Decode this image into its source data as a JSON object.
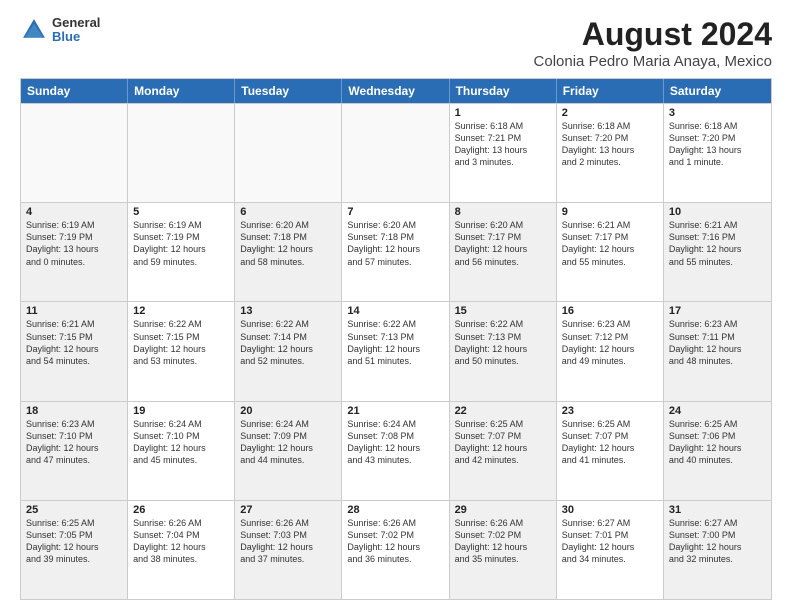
{
  "logo": {
    "general": "General",
    "blue": "Blue"
  },
  "title": "August 2024",
  "subtitle": "Colonia Pedro Maria Anaya, Mexico",
  "header_days": [
    "Sunday",
    "Monday",
    "Tuesday",
    "Wednesday",
    "Thursday",
    "Friday",
    "Saturday"
  ],
  "weeks": [
    [
      {
        "day": "",
        "text": "",
        "empty": true
      },
      {
        "day": "",
        "text": "",
        "empty": true
      },
      {
        "day": "",
        "text": "",
        "empty": true
      },
      {
        "day": "",
        "text": "",
        "empty": true
      },
      {
        "day": "1",
        "text": "Sunrise: 6:18 AM\nSunset: 7:21 PM\nDaylight: 13 hours\nand 3 minutes.",
        "empty": false
      },
      {
        "day": "2",
        "text": "Sunrise: 6:18 AM\nSunset: 7:20 PM\nDaylight: 13 hours\nand 2 minutes.",
        "empty": false
      },
      {
        "day": "3",
        "text": "Sunrise: 6:18 AM\nSunset: 7:20 PM\nDaylight: 13 hours\nand 1 minute.",
        "empty": false
      }
    ],
    [
      {
        "day": "4",
        "text": "Sunrise: 6:19 AM\nSunset: 7:19 PM\nDaylight: 13 hours\nand 0 minutes.",
        "empty": false,
        "shaded": true
      },
      {
        "day": "5",
        "text": "Sunrise: 6:19 AM\nSunset: 7:19 PM\nDaylight: 12 hours\nand 59 minutes.",
        "empty": false,
        "shaded": false
      },
      {
        "day": "6",
        "text": "Sunrise: 6:20 AM\nSunset: 7:18 PM\nDaylight: 12 hours\nand 58 minutes.",
        "empty": false,
        "shaded": true
      },
      {
        "day": "7",
        "text": "Sunrise: 6:20 AM\nSunset: 7:18 PM\nDaylight: 12 hours\nand 57 minutes.",
        "empty": false,
        "shaded": false
      },
      {
        "day": "8",
        "text": "Sunrise: 6:20 AM\nSunset: 7:17 PM\nDaylight: 12 hours\nand 56 minutes.",
        "empty": false,
        "shaded": true
      },
      {
        "day": "9",
        "text": "Sunrise: 6:21 AM\nSunset: 7:17 PM\nDaylight: 12 hours\nand 55 minutes.",
        "empty": false,
        "shaded": false
      },
      {
        "day": "10",
        "text": "Sunrise: 6:21 AM\nSunset: 7:16 PM\nDaylight: 12 hours\nand 55 minutes.",
        "empty": false,
        "shaded": true
      }
    ],
    [
      {
        "day": "11",
        "text": "Sunrise: 6:21 AM\nSunset: 7:15 PM\nDaylight: 12 hours\nand 54 minutes.",
        "empty": false,
        "shaded": true
      },
      {
        "day": "12",
        "text": "Sunrise: 6:22 AM\nSunset: 7:15 PM\nDaylight: 12 hours\nand 53 minutes.",
        "empty": false,
        "shaded": false
      },
      {
        "day": "13",
        "text": "Sunrise: 6:22 AM\nSunset: 7:14 PM\nDaylight: 12 hours\nand 52 minutes.",
        "empty": false,
        "shaded": true
      },
      {
        "day": "14",
        "text": "Sunrise: 6:22 AM\nSunset: 7:13 PM\nDaylight: 12 hours\nand 51 minutes.",
        "empty": false,
        "shaded": false
      },
      {
        "day": "15",
        "text": "Sunrise: 6:22 AM\nSunset: 7:13 PM\nDaylight: 12 hours\nand 50 minutes.",
        "empty": false,
        "shaded": true
      },
      {
        "day": "16",
        "text": "Sunrise: 6:23 AM\nSunset: 7:12 PM\nDaylight: 12 hours\nand 49 minutes.",
        "empty": false,
        "shaded": false
      },
      {
        "day": "17",
        "text": "Sunrise: 6:23 AM\nSunset: 7:11 PM\nDaylight: 12 hours\nand 48 minutes.",
        "empty": false,
        "shaded": true
      }
    ],
    [
      {
        "day": "18",
        "text": "Sunrise: 6:23 AM\nSunset: 7:10 PM\nDaylight: 12 hours\nand 47 minutes.",
        "empty": false,
        "shaded": true
      },
      {
        "day": "19",
        "text": "Sunrise: 6:24 AM\nSunset: 7:10 PM\nDaylight: 12 hours\nand 45 minutes.",
        "empty": false,
        "shaded": false
      },
      {
        "day": "20",
        "text": "Sunrise: 6:24 AM\nSunset: 7:09 PM\nDaylight: 12 hours\nand 44 minutes.",
        "empty": false,
        "shaded": true
      },
      {
        "day": "21",
        "text": "Sunrise: 6:24 AM\nSunset: 7:08 PM\nDaylight: 12 hours\nand 43 minutes.",
        "empty": false,
        "shaded": false
      },
      {
        "day": "22",
        "text": "Sunrise: 6:25 AM\nSunset: 7:07 PM\nDaylight: 12 hours\nand 42 minutes.",
        "empty": false,
        "shaded": true
      },
      {
        "day": "23",
        "text": "Sunrise: 6:25 AM\nSunset: 7:07 PM\nDaylight: 12 hours\nand 41 minutes.",
        "empty": false,
        "shaded": false
      },
      {
        "day": "24",
        "text": "Sunrise: 6:25 AM\nSunset: 7:06 PM\nDaylight: 12 hours\nand 40 minutes.",
        "empty": false,
        "shaded": true
      }
    ],
    [
      {
        "day": "25",
        "text": "Sunrise: 6:25 AM\nSunset: 7:05 PM\nDaylight: 12 hours\nand 39 minutes.",
        "empty": false,
        "shaded": true
      },
      {
        "day": "26",
        "text": "Sunrise: 6:26 AM\nSunset: 7:04 PM\nDaylight: 12 hours\nand 38 minutes.",
        "empty": false,
        "shaded": false
      },
      {
        "day": "27",
        "text": "Sunrise: 6:26 AM\nSunset: 7:03 PM\nDaylight: 12 hours\nand 37 minutes.",
        "empty": false,
        "shaded": true
      },
      {
        "day": "28",
        "text": "Sunrise: 6:26 AM\nSunset: 7:02 PM\nDaylight: 12 hours\nand 36 minutes.",
        "empty": false,
        "shaded": false
      },
      {
        "day": "29",
        "text": "Sunrise: 6:26 AM\nSunset: 7:02 PM\nDaylight: 12 hours\nand 35 minutes.",
        "empty": false,
        "shaded": true
      },
      {
        "day": "30",
        "text": "Sunrise: 6:27 AM\nSunset: 7:01 PM\nDaylight: 12 hours\nand 34 minutes.",
        "empty": false,
        "shaded": false
      },
      {
        "day": "31",
        "text": "Sunrise: 6:27 AM\nSunset: 7:00 PM\nDaylight: 12 hours\nand 32 minutes.",
        "empty": false,
        "shaded": true
      }
    ]
  ]
}
